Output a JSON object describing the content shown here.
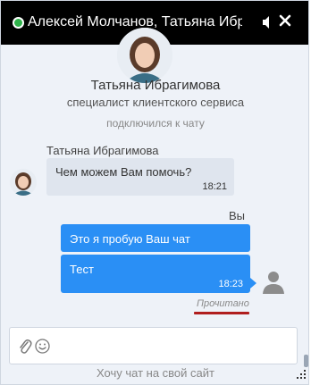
{
  "header": {
    "title": "Алексей Молчанов, Татьяна Ибрагимова",
    "status_color": "#2fb24a",
    "sound_icon": "speaker-icon",
    "close_icon": "close-icon"
  },
  "operator": {
    "name": "Татьяна Ибрагимова",
    "role": "специалист клиентского сервиса",
    "joined_text": "подключился к чату"
  },
  "messages": {
    "incoming": {
      "sender": "Татьяна Ибрагимова",
      "text": "Чем можем Вам помочь?",
      "time": "18:21"
    },
    "outgoing": {
      "sender": "Вы",
      "items": [
        {
          "text": "Это я пробую Ваш чат",
          "time": ""
        },
        {
          "text": "Тест",
          "time": "18:23"
        }
      ],
      "status": "Прочитано"
    }
  },
  "composer": {
    "placeholder": "",
    "attach_icon": "paperclip-icon",
    "emoji_icon": "smiley-icon"
  },
  "footer": {
    "link": "Хочу чат на свой сайт"
  },
  "colors": {
    "header_bg": "#000000",
    "outgoing_bubble": "#2a8ff5",
    "incoming_bubble": "#dfe5ee",
    "chat_bg": "#eef2f8",
    "read_underline": "#b01e1e"
  }
}
